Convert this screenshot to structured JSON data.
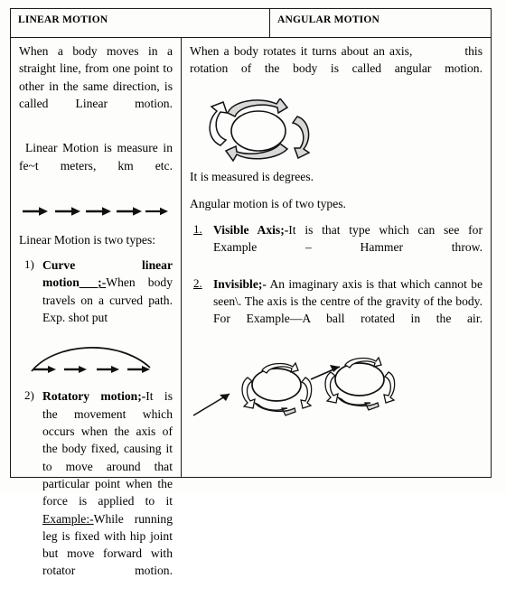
{
  "document": {
    "type": "comparison-table",
    "columns": [
      {
        "header": "LINEAR MOTION",
        "id": "linear-motion"
      },
      {
        "header": "ANGULAR MOTION",
        "id": "angular-motion"
      }
    ]
  },
  "left": {
    "header": "LINEAR MOTION",
    "para1": "When a body moves in a straight line, from one  point to other in the same direction, is called Linear motion.",
    "para2": "Linear Motion is measure in fe~t meters, km etc.",
    "para3": "Linear Motion is two types:",
    "figure1_label": "five-straight-arrows",
    "items": [
      {
        "marker": "1)",
        "bold": "Curve linear motion",
        "bold_tail": "___;-",
        "text": "When body travels on a curved path. Exp. shot put"
      },
      {
        "marker": "2)",
        "bold": "Rotatory motion;-",
        "bold_tail": "",
        "text": "It is the movement which occurs when the axis of the body fixed, causing it to move around that particular  point when the force is applied to it",
        "example_label": "Example:-",
        "example_text": "While running leg is fixed with hip joint but move forward with rotator motion."
      }
    ],
    "figure2_label": "curved-arc-with-arrows"
  },
  "right": {
    "header": "ANGULAR MOTION",
    "para1_a": "When a body rotates it turns about an axis,",
    "para1_b": "this rotation of the body is called angular motion.",
    "figure1_label": "rotation-circular-arrows",
    "para2": "It is measured is degrees.",
    "para3": "Angular motion is of two types.",
    "items": [
      {
        "marker": "1.",
        "bold": "Visible Axis;-",
        "text": "It is that type which can see for Example – Hammer throw."
      },
      {
        "marker": "2.",
        "bold": "Invisible;-",
        "text": "An imaginary axis is that which cannot be seen\\. The axis is the centre of the gravity of the body. For Example—A ball rotated in the air."
      }
    ],
    "figure2_label": "two-rotating-balls-with-motion-arrow"
  },
  "colors": {
    "ink": "#1a1a1a",
    "paper": "#fdfdfc",
    "figure_fill": "#d8d8d8"
  }
}
